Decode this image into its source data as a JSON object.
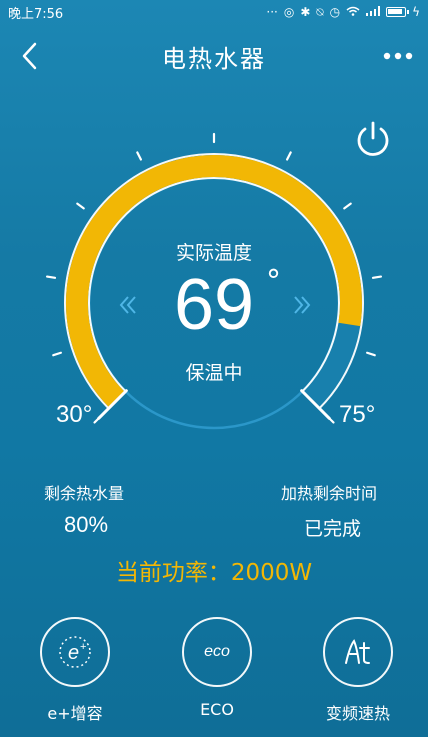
{
  "status_bar": {
    "time": "晚上7:56",
    "icons": [
      "dots-icon",
      "alarm-icon",
      "bluetooth-icon",
      "mute-icon",
      "clock-icon",
      "wifi-icon",
      "signal-icon",
      "battery-icon",
      "charging-icon"
    ],
    "battery_level": 0.9
  },
  "header": {
    "title": "电热水器",
    "back_icon": "chevron-left-icon",
    "more_icon": "more-dots-icon"
  },
  "power_icon": "power-icon",
  "dial": {
    "label": "实际温度",
    "value": "69",
    "degree": "°",
    "status": "保温中",
    "min_label": "30°",
    "max_label": "75°",
    "min": 30,
    "max": 75,
    "current": 69,
    "colors": {
      "active": "#f2b705",
      "track": "#ffffff",
      "inner": "#0f5e86"
    }
  },
  "info": {
    "hot_water_label": "剩余热水量",
    "hot_water_value": "80%",
    "hot_water_fraction": 0.8,
    "heat_time_label": "加热剩余时间",
    "heat_time_value": "已完成"
  },
  "power_line": "当前功率：2000W",
  "functions": [
    {
      "label": "e+增容",
      "icon": "e-plus-icon"
    },
    {
      "label": "ECO",
      "icon": "eco-icon",
      "icon_text": "eco"
    },
    {
      "label": "变频速热",
      "icon": "rapid-heat-icon"
    }
  ],
  "accent": "#f2b705"
}
